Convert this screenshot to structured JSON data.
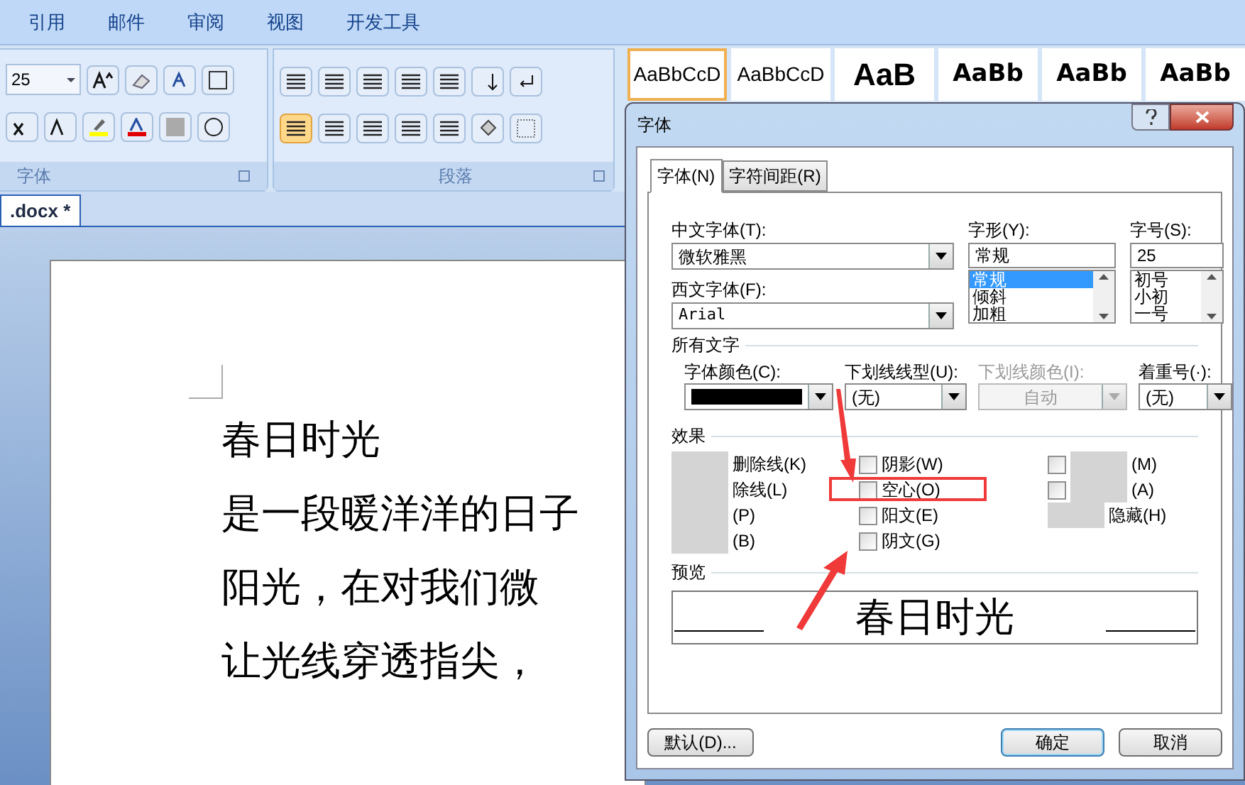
{
  "ribbon_tabs": [
    "引用",
    "邮件",
    "审阅",
    "视图",
    "开发工具"
  ],
  "font_group": {
    "size": "25",
    "label": "字体"
  },
  "paragraph_group": {
    "label": "段落",
    "align_left_selected": true
  },
  "style_gallery": [
    {
      "sample": "AaBbCcD",
      "kind": "normal",
      "selected": true
    },
    {
      "sample": "AaBbCcD",
      "kind": "normal",
      "selected": false
    },
    {
      "sample": "AaB",
      "kind": "bold",
      "selected": false
    },
    {
      "sample": "AaBb",
      "kind": "heading",
      "selected": false
    },
    {
      "sample": "AaBb",
      "kind": "heading",
      "selected": false
    },
    {
      "sample": "AaBb",
      "kind": "heading",
      "selected": false
    }
  ],
  "document_tab": ".docx *",
  "document": {
    "paragraphs": [
      "春日时光",
      "是一段暖洋洋的日子",
      "阳光，在对我们微",
      "让光线穿透指尖，"
    ]
  },
  "dialog": {
    "title": "字体",
    "tabs": [
      {
        "label": "字体(N)",
        "selected": true
      },
      {
        "label": "字符间距(R)",
        "selected": false
      }
    ],
    "chinese_font": {
      "label": "中文字体(T):",
      "value": "微软雅黑"
    },
    "western_font": {
      "label": "西文字体(F):",
      "value": "Arial"
    },
    "font_style": {
      "label": "字形(Y):",
      "value": "常规",
      "options": [
        {
          "label": "常规",
          "selected": true
        },
        {
          "label": "倾斜",
          "selected": false
        },
        {
          "label": "加粗",
          "selected": false
        }
      ]
    },
    "font_size": {
      "label": "字号(S):",
      "value": "25",
      "options": [
        {
          "label": "初号",
          "selected": false
        },
        {
          "label": "小初",
          "selected": false
        },
        {
          "label": "一号",
          "selected": false
        }
      ]
    },
    "all_text_heading": "所有文字",
    "font_color": {
      "label": "字体颜色(C):",
      "color": "#000000"
    },
    "underline_style": {
      "label": "下划线线型(U):",
      "value": "(无)",
      "disabled": false
    },
    "underline_color": {
      "label": "下划线颜色(I):",
      "value": "自动",
      "disabled": true
    },
    "emphasis_mark": {
      "label": "着重号(·):",
      "value": "(无)",
      "disabled": false
    },
    "effects_heading": "效果",
    "effects": [
      [
        {
          "label": "删除线(K)",
          "obscured": true
        },
        {
          "label": "除线(L)",
          "obscured": true
        },
        {
          "label": "(P)",
          "obscured": true
        },
        {
          "label": "(B)",
          "obscured": true
        }
      ],
      [
        {
          "label": "阴影(W)",
          "checked": false
        },
        {
          "label": "空心(O)",
          "checked": false
        },
        {
          "label": "阳文(E)",
          "checked": false
        },
        {
          "label": "阴文(G)",
          "checked": false
        }
      ],
      [
        {
          "label": "(M)",
          "checked": false,
          "obscured": true
        },
        {
          "label": "(A)",
          "checked": false,
          "obscured": true
        },
        {
          "label": "隐藏(H)",
          "obscured": true
        }
      ]
    ],
    "preview_heading": "预览",
    "preview_text": "春日时光",
    "buttons": [
      {
        "label": "默认(D)...",
        "default": false
      },
      {
        "label": "确定",
        "default": true
      },
      {
        "label": "取消",
        "default": false
      }
    ]
  }
}
